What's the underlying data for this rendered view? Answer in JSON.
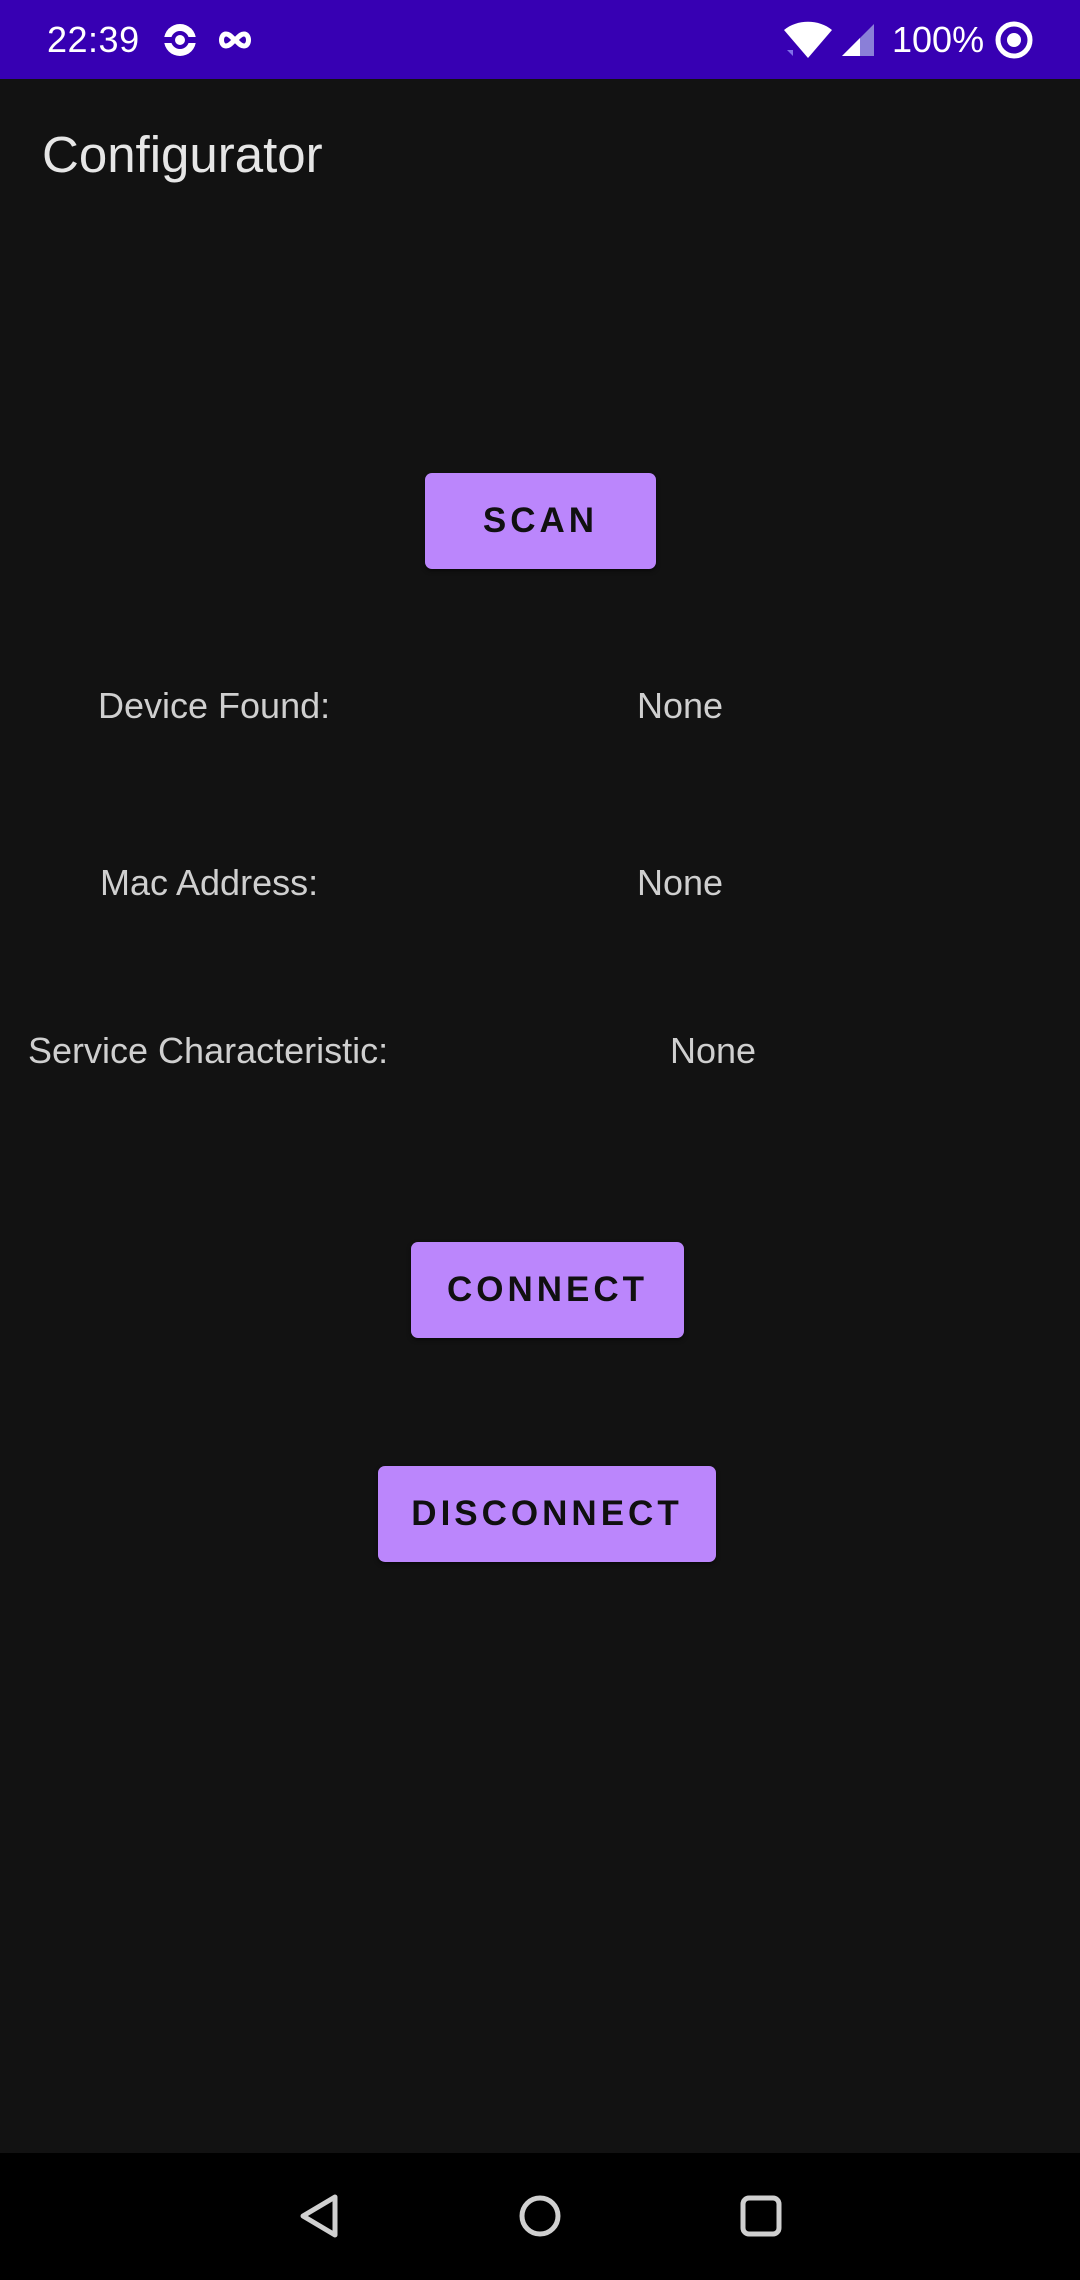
{
  "status_bar": {
    "time": "22:39",
    "battery": "100%",
    "icons": [
      "app-notification-icon",
      "infinity-icon",
      "wifi-icon",
      "signal-icon",
      "circle-target-icon"
    ],
    "background": "#3700b3"
  },
  "app_bar": {
    "title": "Configurator"
  },
  "buttons": {
    "scan": "SCAN",
    "connect": "CONNECT",
    "disconnect": "DISCONNECT",
    "color": "#bb86fc"
  },
  "info": {
    "device_found_label": "Device Found:",
    "device_found_value": "None",
    "mac_address_label": "Mac Address:",
    "mac_address_value": "None",
    "service_characteristic_label": "Service Characteristic:",
    "service_characteristic_value": "None"
  },
  "nav_bar": {
    "icons": [
      "back-icon",
      "home-icon",
      "recents-icon"
    ]
  }
}
